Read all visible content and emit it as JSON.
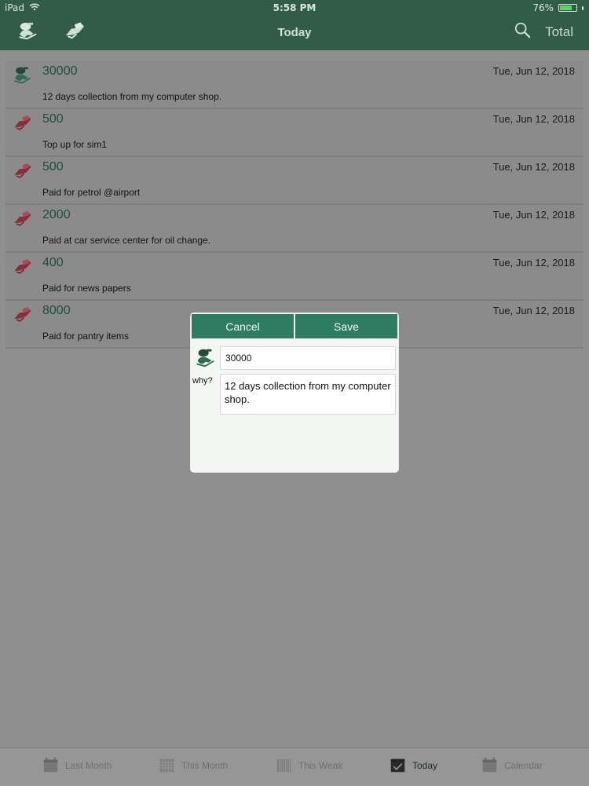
{
  "status": {
    "device": "iPad",
    "time": "5:58 PM",
    "battery_text": "76%",
    "battery_level": 0.76,
    "icons": {
      "wifi": "wifi-icon",
      "battery": "battery-icon"
    }
  },
  "header": {
    "title": "Today",
    "total_label": "Total",
    "left_actions": [
      "income-icon",
      "expense-icon"
    ],
    "right_actions": [
      "search-icon"
    ]
  },
  "transactions": [
    {
      "type": "income",
      "amount": "30000",
      "date": "Tue, Jun 12, 2018",
      "note": "12 days collection from my computer shop."
    },
    {
      "type": "expense",
      "amount": "500",
      "date": "Tue, Jun 12, 2018",
      "note": "Top up for sim1"
    },
    {
      "type": "expense",
      "amount": "500",
      "date": "Tue, Jun 12, 2018",
      "note": "Paid for petrol @airport"
    },
    {
      "type": "expense",
      "amount": "2000",
      "date": "Tue, Jun 12, 2018",
      "note": "Paid at car service center for oil change."
    },
    {
      "type": "expense",
      "amount": "400",
      "date": "Tue, Jun 12, 2018",
      "note": "Paid for news papers"
    },
    {
      "type": "expense",
      "amount": "8000",
      "date": "Tue, Jun 12, 2018",
      "note": "Paid for pantry items"
    }
  ],
  "dialog": {
    "cancel_label": "Cancel",
    "save_label": "Save",
    "amount_value": "30000",
    "why_label": "why?",
    "note_value": "12 days collection from my computer shop.",
    "icon": "income-icon"
  },
  "tabs": [
    {
      "label": "Last Month",
      "icon": "calendar-icon",
      "active": false
    },
    {
      "label": "This Month",
      "icon": "grid-calendar-icon",
      "active": false
    },
    {
      "label": "This Weak",
      "icon": "week-calendar-icon",
      "active": false
    },
    {
      "label": "Today",
      "icon": "today-check-icon",
      "active": true
    },
    {
      "label": "Calendar",
      "icon": "calendar-icon",
      "active": false
    }
  ],
  "colors": {
    "header_bg": "#315c48",
    "accent_green": "#2e7d62",
    "expense_red": "#8a2d3b"
  }
}
